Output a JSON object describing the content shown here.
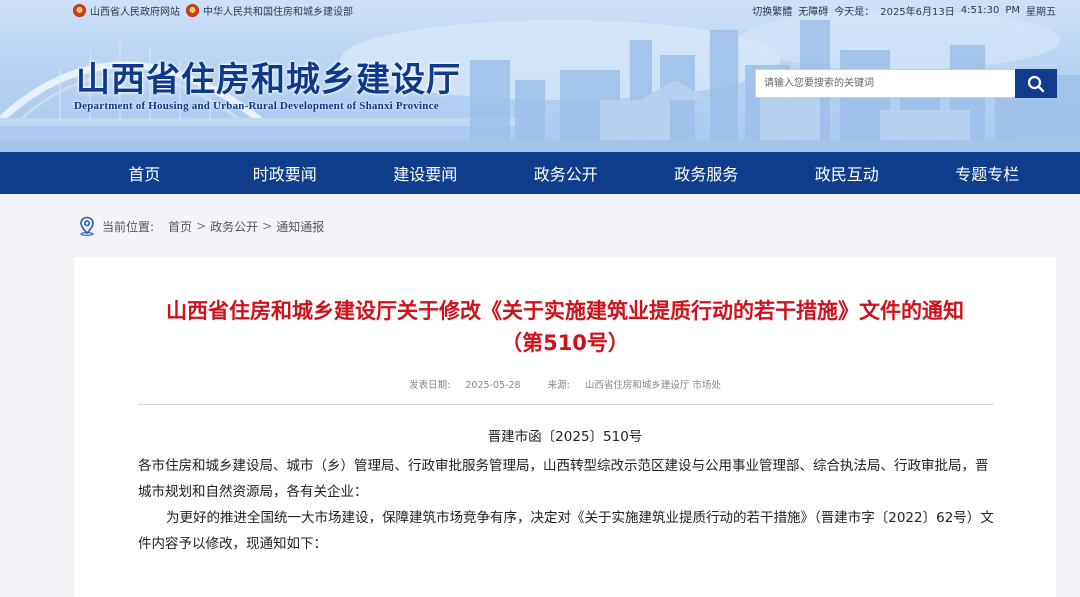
{
  "topbar": {
    "links": [
      {
        "label": "山西省人民政府网站"
      },
      {
        "label": "中华人民共和国住房和城乡建设部"
      }
    ],
    "switch_lang": "切换繁體",
    "accessibility": "无障碍",
    "today_label": "今天是：",
    "date": "2025年6月13日",
    "time": "4:51:30",
    "ampm": "PM",
    "weekday": "星期五"
  },
  "site": {
    "title": "山西省住房和城乡建设厅",
    "subtitle": "Department of Housing and Urban-Rural Development of Shanxi Province"
  },
  "search": {
    "placeholder": "请输入您要搜索的关键词",
    "icon": "search-icon"
  },
  "nav": {
    "items": [
      {
        "label": "首页"
      },
      {
        "label": "时政要闻"
      },
      {
        "label": "建设要闻"
      },
      {
        "label": "政务公开"
      },
      {
        "label": "政务服务"
      },
      {
        "label": "政民互动"
      },
      {
        "label": "专题专栏"
      }
    ]
  },
  "breadcrumb": {
    "label": "当前位置:",
    "items": [
      "首页",
      "政务公开",
      "通知通报"
    ],
    "icon": "location-pin-icon"
  },
  "article": {
    "title": "山西省住房和城乡建设厅关于修改《关于实施建筑业提质行动的若干措施》文件的通知（第510号）",
    "publish_label": "发表日期:",
    "publish_date": "2025-05-28",
    "source_label": "来源:",
    "source": "山西省住房和城乡建设厅 市场处",
    "doc_number": "晋建市函〔2025〕510号",
    "recipients": "各市住房和城乡建设局、城市（乡）管理局、行政审批服务管理局，山西转型综改示范区建设与公用事业管理部、综合执法局、行政审批局，晋城市规划和自然资源局，各有关企业：",
    "paragraph1": "为更好的推进全国统一大市场建设，保障建筑市场竞争有序，决定对《关于实施建筑业提质行动的若干措施》（晋建市字〔2022〕62号）文件内容予以修改，现通知如下："
  },
  "colors": {
    "nav_bg": "#0f3e8c",
    "title_red": "#d0111b",
    "brand_blue": "#0d3a8a"
  }
}
